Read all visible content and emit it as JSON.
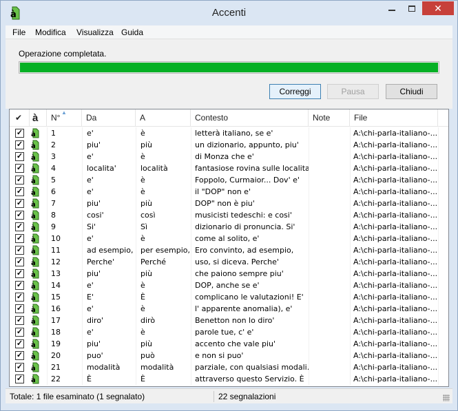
{
  "window": {
    "title": "Accenti",
    "app_icon": "a-grave-doc-icon",
    "min_icon": "minimize-icon",
    "max_icon": "maximize-icon",
    "close_icon": "close-icon",
    "close_color": "#c7403a"
  },
  "menu": {
    "items": [
      "File",
      "Modifica",
      "Visualizza",
      "Guida"
    ]
  },
  "progress": {
    "message": "Operazione completata.",
    "value_percent": 100,
    "color": "#06b025"
  },
  "buttons": {
    "fix": "Correggi",
    "pause": "Pausa",
    "close": "Chiudi"
  },
  "list": {
    "columns": {
      "check": "✔",
      "icon": "à",
      "num": "N°",
      "da": "Da",
      "a": "A",
      "contesto": "Contesto",
      "note": "Note",
      "file": "File"
    },
    "rows": [
      {
        "checked": true,
        "num": "1",
        "da": "e'",
        "a": "è",
        "contesto": "letterà italiano, se e'",
        "note": "",
        "file": "A:\\chi-parla-italiano-..."
      },
      {
        "checked": true,
        "num": "2",
        "da": "piu'",
        "a": "più",
        "contesto": "un dizionario, appunto, piu'",
        "note": "",
        "file": "A:\\chi-parla-italiano-..."
      },
      {
        "checked": true,
        "num": "3",
        "da": "e'",
        "a": "è",
        "contesto": "di Monza che e'",
        "note": "",
        "file": "A:\\chi-parla-italiano-..."
      },
      {
        "checked": true,
        "num": "4",
        "da": "localita'",
        "a": "località",
        "contesto": "fantasiose rovina sulle localita'",
        "note": "",
        "file": "A:\\chi-parla-italiano-..."
      },
      {
        "checked": true,
        "num": "5",
        "da": "e'",
        "a": "è",
        "contesto": "Foppolo, Curmaior... Dov' e'",
        "note": "",
        "file": "A:\\chi-parla-italiano-..."
      },
      {
        "checked": true,
        "num": "6",
        "da": "e'",
        "a": "è",
        "contesto": "il \"DOP\" non e'",
        "note": "",
        "file": "A:\\chi-parla-italiano-..."
      },
      {
        "checked": true,
        "num": "7",
        "da": "piu'",
        "a": "più",
        "contesto": "DOP\" non è piu'",
        "note": "",
        "file": "A:\\chi-parla-italiano-..."
      },
      {
        "checked": true,
        "num": "8",
        "da": "cosi'",
        "a": "così",
        "contesto": "musicisti tedeschi: e cosi'",
        "note": "",
        "file": "A:\\chi-parla-italiano-..."
      },
      {
        "checked": true,
        "num": "9",
        "da": "Si'",
        "a": "Sì",
        "contesto": "dizionario di pronuncia. Si'",
        "note": "",
        "file": "A:\\chi-parla-italiano-..."
      },
      {
        "checked": true,
        "num": "10",
        "da": "e'",
        "a": "è",
        "contesto": "come al solito, e'",
        "note": "",
        "file": "A:\\chi-parla-italiano-..."
      },
      {
        "checked": true,
        "num": "11",
        "da": "ad esempio,",
        "a": "per esempio,",
        "contesto": "Ero convinto, ad esempio,",
        "note": "",
        "file": "A:\\chi-parla-italiano-..."
      },
      {
        "checked": true,
        "num": "12",
        "da": "Perche'",
        "a": "Perché",
        "contesto": "uso, si diceva. Perche'",
        "note": "",
        "file": "A:\\chi-parla-italiano-..."
      },
      {
        "checked": true,
        "num": "13",
        "da": "piu'",
        "a": "più",
        "contesto": "che paiono sempre piu'",
        "note": "",
        "file": "A:\\chi-parla-italiano-..."
      },
      {
        "checked": true,
        "num": "14",
        "da": "e'",
        "a": "è",
        "contesto": "DOP, anche se e'",
        "note": "",
        "file": "A:\\chi-parla-italiano-..."
      },
      {
        "checked": true,
        "num": "15",
        "da": "E'",
        "a": "È",
        "contesto": "complicano le valutazioni! E'",
        "note": "",
        "file": "A:\\chi-parla-italiano-..."
      },
      {
        "checked": true,
        "num": "16",
        "da": "e'",
        "a": "è",
        "contesto": "l' apparente anomalia), e'",
        "note": "",
        "file": "A:\\chi-parla-italiano-..."
      },
      {
        "checked": true,
        "num": "17",
        "da": "diro'",
        "a": "dirò",
        "contesto": "Benetton non lo diro'",
        "note": "",
        "file": "A:\\chi-parla-italiano-..."
      },
      {
        "checked": true,
        "num": "18",
        "da": "e'",
        "a": "è",
        "contesto": "parole tue, c' e'",
        "note": "",
        "file": "A:\\chi-parla-italiano-..."
      },
      {
        "checked": true,
        "num": "19",
        "da": "piu'",
        "a": "più",
        "contesto": "accento che vale piu'",
        "note": "",
        "file": "A:\\chi-parla-italiano-..."
      },
      {
        "checked": true,
        "num": "20",
        "da": "puo'",
        "a": "può",
        "contesto": "e non si puo'",
        "note": "",
        "file": "A:\\chi-parla-italiano-..."
      },
      {
        "checked": true,
        "num": "21",
        "da": "modalità",
        "a": "modalità",
        "contesto": "parziale, con qualsiasi modali...",
        "note": "",
        "file": "A:\\chi-parla-italiano-..."
      },
      {
        "checked": true,
        "num": "22",
        "da": "È",
        "a": "È",
        "contesto": "attraverso questo Servizio. È",
        "note": "",
        "file": "A:\\chi-parla-italiano-..."
      }
    ]
  },
  "statusbar": {
    "left": "Totale: 1 file esaminato (1 segnalato)",
    "right": "22 segnalazioni"
  }
}
